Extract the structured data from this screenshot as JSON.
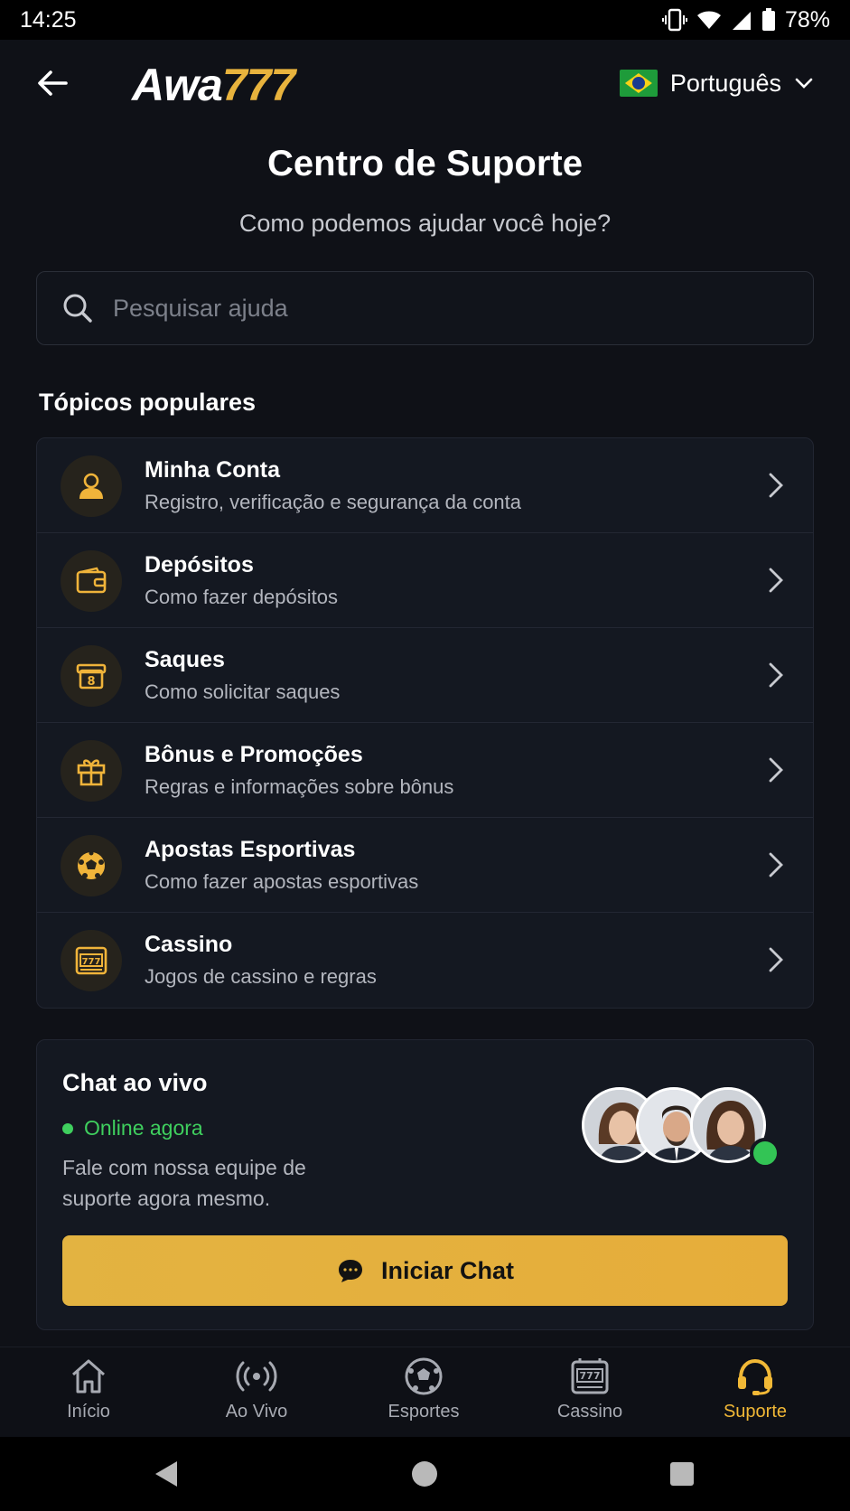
{
  "status_bar": {
    "time": "14:25",
    "battery": "78%"
  },
  "header": {
    "logo_part1": "Awa",
    "logo_part2": "777",
    "language": "Português"
  },
  "page": {
    "title": "Centro de Suporte",
    "subtitle": "Como podemos ajudar você hoje?"
  },
  "search": {
    "placeholder": "Pesquisar ajuda"
  },
  "topics": {
    "heading": "Tópicos populares",
    "items": [
      {
        "icon": "user-icon",
        "title": "Minha Conta",
        "desc": "Registro, verificação e segurança da conta"
      },
      {
        "icon": "wallet-icon",
        "title": "Depósitos",
        "desc": "Como fazer depósitos"
      },
      {
        "icon": "cash-icon",
        "title": "Saques",
        "desc": "Como solicitar saques"
      },
      {
        "icon": "gift-icon",
        "title": "Bônus e Promoções",
        "desc": "Regras e informações sobre bônus"
      },
      {
        "icon": "soccer-ball-icon",
        "title": "Apostas Esportivas",
        "desc": "Como fazer apostas esportivas"
      },
      {
        "icon": "slot-machine-icon",
        "title": "Cassino",
        "desc": "Jogos de cassino e regras"
      }
    ]
  },
  "live_chat": {
    "title": "Chat ao vivo",
    "status": "Online agora",
    "desc": "Fale com nossa equipe de suporte agora mesmo.",
    "button": "Iniciar Chat"
  },
  "tabbar": {
    "items": [
      {
        "label": "Início",
        "icon": "home-icon"
      },
      {
        "label": "Ao Vivo",
        "icon": "live-broadcast-icon"
      },
      {
        "label": "Esportes",
        "icon": "soccer-ball-icon"
      },
      {
        "label": "Cassino",
        "icon": "slot-machine-icon"
      },
      {
        "label": "Suporte",
        "icon": "headset-icon"
      }
    ]
  },
  "colors": {
    "accent": "#e8b33d",
    "online": "#3fcf5e",
    "background": "#0f1117",
    "card": "#141821"
  }
}
